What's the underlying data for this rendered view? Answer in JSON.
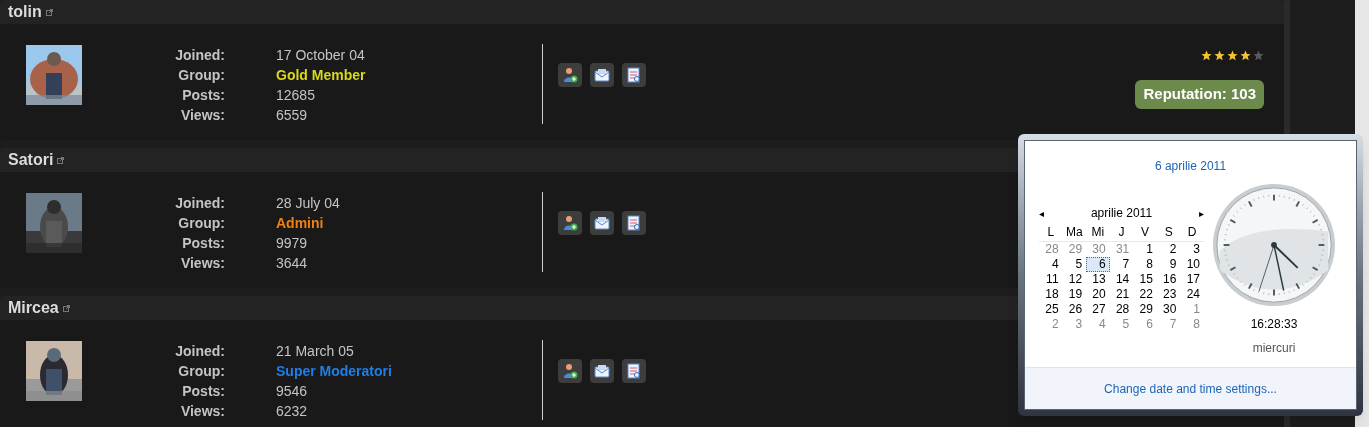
{
  "members": [
    {
      "name": "tolin",
      "fields": [
        {
          "label": "Joined:",
          "value": "17 October 04",
          "kind": "text"
        },
        {
          "label": "Group:",
          "value": "Gold Member",
          "kind": "group",
          "color": "#d8d81e"
        },
        {
          "label": "Posts:",
          "value": "12685",
          "kind": "text"
        },
        {
          "label": "Views:",
          "value": "6559",
          "kind": "text"
        }
      ],
      "stars": 4,
      "reputation": "Reputation: 103"
    },
    {
      "name": "Satori",
      "fields": [
        {
          "label": "Joined:",
          "value": "28 July 04",
          "kind": "text"
        },
        {
          "label": "Group:",
          "value": "Admini",
          "kind": "group",
          "color": "#f07f12"
        },
        {
          "label": "Posts:",
          "value": "9979",
          "kind": "text"
        },
        {
          "label": "Views:",
          "value": "3644",
          "kind": "text"
        }
      ]
    },
    {
      "name": "Mircea",
      "fields": [
        {
          "label": "Joined:",
          "value": "21 March 05",
          "kind": "text"
        },
        {
          "label": "Group:",
          "value": "Super Moderatori",
          "kind": "group",
          "color": "#1f7fe6"
        },
        {
          "label": "Posts:",
          "value": "9546",
          "kind": "text"
        },
        {
          "label": "Views:",
          "value": "6232",
          "kind": "text"
        }
      ]
    }
  ],
  "clock_popup": {
    "date_title": "6 aprilie 2011",
    "prev": "◂",
    "next": "▸",
    "month": "aprilie 2011",
    "weekdays": [
      "L",
      "Ma",
      "Mi",
      "J",
      "V",
      "S",
      "D"
    ],
    "days": [
      {
        "label": "28",
        "in_month": false,
        "selected": false
      },
      {
        "label": "29",
        "in_month": false,
        "selected": false
      },
      {
        "label": "30",
        "in_month": false,
        "selected": false
      },
      {
        "label": "31",
        "in_month": false,
        "selected": false
      },
      {
        "label": "1",
        "in_month": true,
        "selected": false
      },
      {
        "label": "2",
        "in_month": true,
        "selected": false
      },
      {
        "label": "3",
        "in_month": true,
        "selected": false
      },
      {
        "label": "4",
        "in_month": true,
        "selected": false
      },
      {
        "label": "5",
        "in_month": true,
        "selected": false
      },
      {
        "label": "6",
        "in_month": true,
        "selected": true
      },
      {
        "label": "7",
        "in_month": true,
        "selected": false
      },
      {
        "label": "8",
        "in_month": true,
        "selected": false
      },
      {
        "label": "9",
        "in_month": true,
        "selected": false
      },
      {
        "label": "10",
        "in_month": true,
        "selected": false
      },
      {
        "label": "11",
        "in_month": true,
        "selected": false
      },
      {
        "label": "12",
        "in_month": true,
        "selected": false
      },
      {
        "label": "13",
        "in_month": true,
        "selected": false
      },
      {
        "label": "14",
        "in_month": true,
        "selected": false
      },
      {
        "label": "15",
        "in_month": true,
        "selected": false
      },
      {
        "label": "16",
        "in_month": true,
        "selected": false
      },
      {
        "label": "17",
        "in_month": true,
        "selected": false
      },
      {
        "label": "18",
        "in_month": true,
        "selected": false
      },
      {
        "label": "19",
        "in_month": true,
        "selected": false
      },
      {
        "label": "20",
        "in_month": true,
        "selected": false
      },
      {
        "label": "21",
        "in_month": true,
        "selected": false
      },
      {
        "label": "22",
        "in_month": true,
        "selected": false
      },
      {
        "label": "23",
        "in_month": true,
        "selected": false
      },
      {
        "label": "24",
        "in_month": true,
        "selected": false
      },
      {
        "label": "25",
        "in_month": true,
        "selected": false
      },
      {
        "label": "26",
        "in_month": true,
        "selected": false
      },
      {
        "label": "27",
        "in_month": true,
        "selected": false
      },
      {
        "label": "28",
        "in_month": true,
        "selected": false
      },
      {
        "label": "29",
        "in_month": true,
        "selected": false
      },
      {
        "label": "30",
        "in_month": true,
        "selected": false
      },
      {
        "label": "1",
        "in_month": false,
        "selected": false
      },
      {
        "label": "2",
        "in_month": false,
        "selected": false
      },
      {
        "label": "3",
        "in_month": false,
        "selected": false
      },
      {
        "label": "4",
        "in_month": false,
        "selected": false
      },
      {
        "label": "5",
        "in_month": false,
        "selected": false
      },
      {
        "label": "6",
        "in_month": false,
        "selected": false
      },
      {
        "label": "7",
        "in_month": false,
        "selected": false
      },
      {
        "label": "8",
        "in_month": false,
        "selected": false
      }
    ],
    "time": "16:28:33",
    "weekday": "miercuri",
    "settings_link": "Change date and time settings..."
  }
}
